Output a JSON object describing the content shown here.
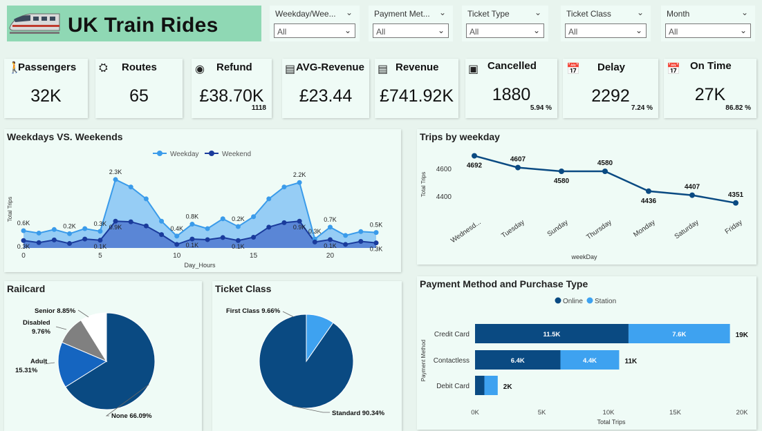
{
  "header": {
    "title": "UK Train Rides"
  },
  "slicers": [
    {
      "label": "Weekday/Wee...",
      "value": "All"
    },
    {
      "label": "Payment Met...",
      "value": "All"
    },
    {
      "label": "Ticket Type",
      "value": "All"
    },
    {
      "label": "Ticket Class",
      "value": "All"
    },
    {
      "label": "Month",
      "value": "All"
    }
  ],
  "kpis": [
    {
      "label": "Passengers",
      "value": "32K",
      "sub": "",
      "icon": "passenger-icon"
    },
    {
      "label": "Routes",
      "value": "65",
      "sub": "",
      "icon": "routes-icon"
    },
    {
      "label": "Refund",
      "value": "£38.70K",
      "sub": "1118",
      "icon": "refund-icon"
    },
    {
      "label": "AVG-Revenue",
      "value": "£23.44",
      "sub": "",
      "icon": "avg-revenue-icon"
    },
    {
      "label": "Revenue",
      "value": "£741.92K",
      "sub": "",
      "icon": "revenue-icon"
    },
    {
      "label": "Cancelled",
      "value": "1880",
      "sub": "5.94 %",
      "icon": "cancelled-icon"
    },
    {
      "label": "Delay",
      "value": "2292",
      "sub": "7.24 %",
      "icon": "delay-icon"
    },
    {
      "label": "On Time",
      "value": "27K",
      "sub": "86.82 %",
      "icon": "on-time-icon"
    }
  ],
  "colors": {
    "weekday": "#3a9bea",
    "weekend": "#1a3b9c",
    "dark_blue": "#0a4a82",
    "light_blue": "#3ea2f0",
    "mid_blue": "#1565c0",
    "gray": "#808080"
  },
  "chart_data": [
    {
      "type": "area",
      "title": "Weekdays VS. Weekends",
      "xlabel": "Day_Hours",
      "ylabel": "Total Trips",
      "x": [
        0,
        1,
        2,
        3,
        4,
        5,
        6,
        7,
        8,
        9,
        10,
        11,
        12,
        13,
        14,
        15,
        16,
        17,
        18,
        19,
        20,
        21,
        22,
        23
      ],
      "x_ticks": [
        0,
        5,
        10,
        15,
        20
      ],
      "series": [
        {
          "name": "Weekday",
          "values": [
            580,
            500,
            620,
            480,
            650,
            560,
            2300,
            2050,
            1650,
            900,
            400,
            800,
            650,
            980,
            720,
            1050,
            1650,
            2050,
            2200,
            300,
            700,
            420,
            550,
            520
          ]
        },
        {
          "name": "Weekend",
          "values": [
            250,
            180,
            270,
            150,
            300,
            260,
            900,
            880,
            740,
            450,
            120,
            300,
            280,
            350,
            250,
            360,
            700,
            850,
            900,
            200,
            280,
            120,
            220,
            170
          ]
        }
      ],
      "data_labels": [
        {
          "text": "0.6K",
          "x": 0,
          "series": "Weekday"
        },
        {
          "text": "0.3K",
          "x": 0,
          "series": "Weekend"
        },
        {
          "text": "0.2K",
          "x": 3,
          "series": "Weekday"
        },
        {
          "text": "0.3K",
          "x": 5,
          "series": "Weekday"
        },
        {
          "text": "0.1K",
          "x": 5,
          "series": "Weekend"
        },
        {
          "text": "2.3K",
          "x": 6,
          "series": "Weekday"
        },
        {
          "text": "0.9K",
          "x": 6,
          "series": "Weekend"
        },
        {
          "text": "0.4K",
          "x": 10,
          "series": "Weekday"
        },
        {
          "text": "0.1K",
          "x": 11,
          "series": "Weekend"
        },
        {
          "text": "0.8K",
          "x": 11,
          "series": "Weekday"
        },
        {
          "text": "0.1K",
          "x": 14,
          "series": "Weekend"
        },
        {
          "text": "0.2K",
          "x": 14,
          "series": "Weekday"
        },
        {
          "text": "2.2K",
          "x": 18,
          "series": "Weekday"
        },
        {
          "text": "0.9K",
          "x": 18,
          "series": "Weekend"
        },
        {
          "text": "0.3K",
          "x": 19,
          "series": "Weekday"
        },
        {
          "text": "0.7K",
          "x": 20,
          "series": "Weekday"
        },
        {
          "text": "0.1K",
          "x": 20,
          "series": "Weekend"
        },
        {
          "text": "0.5K",
          "x": 23,
          "series": "Weekday"
        },
        {
          "text": "0.3K",
          "x": 23,
          "series": "Weekend"
        }
      ],
      "ylim": [
        0,
        2600
      ],
      "legend": "top-center"
    },
    {
      "type": "line",
      "title": "Trips by weekday",
      "xlabel": "weekDay",
      "ylabel": "Total Trips",
      "categories": [
        "Wednesd...",
        "Tuesday",
        "Sunday",
        "Thursday",
        "Monday",
        "Saturday",
        "Friday"
      ],
      "values": [
        4692,
        4607,
        4580,
        4580,
        4436,
        4407,
        4351
      ],
      "y_ticks": [
        4400,
        4600
      ],
      "ylim": [
        4300,
        4720
      ]
    },
    {
      "type": "pie",
      "title": "Railcard",
      "slices": [
        {
          "label": "None",
          "value": 66.09,
          "display": "None 66.09%",
          "color": "#0a4a82"
        },
        {
          "label": "Adult",
          "value": 15.31,
          "display": "15.31%",
          "color": "#1565c0"
        },
        {
          "label": "Disabled",
          "value": 9.76,
          "display": "9.76%",
          "color": "#808080"
        },
        {
          "label": "Senior",
          "value": 8.85,
          "display": "Senior 8.85%",
          "color": "#ffffff"
        }
      ]
    },
    {
      "type": "pie",
      "title": "Ticket Class",
      "slices": [
        {
          "label": "Standard",
          "value": 90.34,
          "display": "Standard 90.34%",
          "color": "#0a4a82"
        },
        {
          "label": "First Class",
          "value": 9.66,
          "display": "First Class 9.66%",
          "color": "#3ea2f0"
        }
      ]
    },
    {
      "type": "bar",
      "orientation": "horizontal",
      "stacked": true,
      "title": "Payment Method and Purchase Type",
      "xlabel": "Total Trips",
      "ylabel": "Payment Method",
      "categories": [
        "Credit Card",
        "Contactless",
        "Debit Card"
      ],
      "series": [
        {
          "name": "Online",
          "values": [
            11500,
            6400,
            700
          ],
          "labels": [
            "11.5K",
            "6.4K",
            ""
          ]
        },
        {
          "name": "Station",
          "values": [
            7600,
            4400,
            1000
          ],
          "labels": [
            "7.6K",
            "4.4K",
            ""
          ]
        }
      ],
      "totals": [
        "19K",
        "11K",
        "2K"
      ],
      "x_ticks": [
        "0K",
        "5K",
        "10K",
        "15K",
        "20K"
      ],
      "xlim": [
        0,
        20000
      ],
      "legend": "top-left"
    }
  ]
}
